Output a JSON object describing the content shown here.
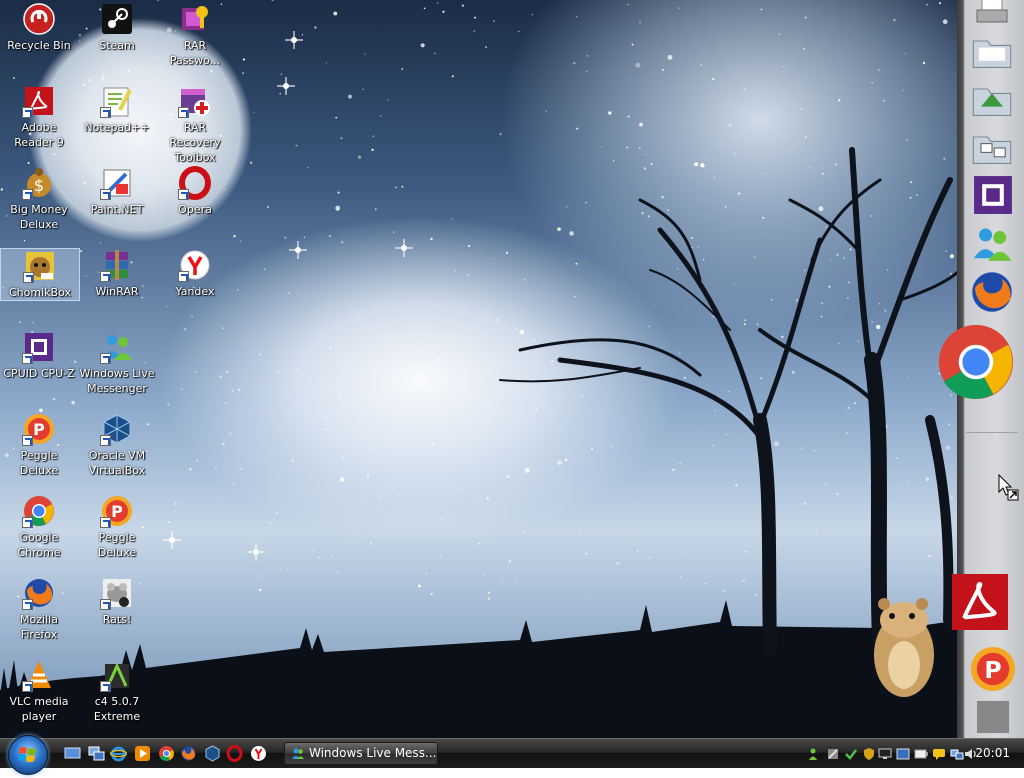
{
  "desktop": {
    "icons": [
      {
        "label": "Recycle Bin",
        "icon": "recycle-bin-icon"
      },
      {
        "label": "Steam",
        "icon": "steam-icon"
      },
      {
        "label": "RAR Passwo...",
        "icon": "rar-password-icon"
      },
      {
        "label": "Adobe Reader 9",
        "icon": "adobe-reader-icon"
      },
      {
        "label": "Notepad++",
        "icon": "notepad-plus-plus-icon"
      },
      {
        "label": "RAR Recovery Toolbox",
        "icon": "rar-recovery-toolbox-icon"
      },
      {
        "label": "Big Money Deluxe",
        "icon": "big-money-deluxe-icon"
      },
      {
        "label": "Paint.NET",
        "icon": "paint-net-icon"
      },
      {
        "label": "Opera",
        "icon": "opera-icon"
      },
      {
        "label": "ChomikBox",
        "icon": "chomikbox-icon"
      },
      {
        "label": "WinRAR",
        "icon": "winrar-icon"
      },
      {
        "label": "Yandex",
        "icon": "yandex-icon"
      },
      {
        "label": "CPUID CPU-Z",
        "icon": "cpu-z-icon"
      },
      {
        "label": "Windows Live Messenger",
        "icon": "messenger-icon"
      },
      {
        "label": "Peggle Deluxe",
        "icon": "peggle-icon"
      },
      {
        "label": "Oracle VM VirtualBox",
        "icon": "virtualbox-icon"
      },
      {
        "label": "Google Chrome",
        "icon": "chrome-icon"
      },
      {
        "label": "Peggle Deluxe",
        "icon": "peggle-icon"
      },
      {
        "label": "Mozilla Firefox",
        "icon": "firefox-icon"
      },
      {
        "label": "Rats!",
        "icon": "rats-icon"
      },
      {
        "label": "VLC media player",
        "icon": "vlc-icon"
      },
      {
        "label": "c4 5.0.7 Extreme",
        "icon": "c4-extreme-icon"
      }
    ],
    "selected_label": "ChomikBox"
  },
  "dock": {
    "items": [
      "printer-icon",
      "folder-icon",
      "folder-green-icon",
      "folder-network-icon",
      "cpu-z-icon",
      "messenger-icon",
      "firefox-icon",
      "chrome-icon",
      "adobe-reader-icon",
      "peggle-icon",
      "paint-icon"
    ]
  },
  "taskbar": {
    "start_button": "windows-orb-icon",
    "quick_launch": [
      "show-desktop-icon",
      "switch-windows-icon",
      "internet-explorer-icon",
      "media-player-icon",
      "chrome-icon",
      "firefox-icon",
      "virtualbox-icon",
      "opera-icon",
      "yandex-icon"
    ],
    "task_button_label": "Windows Live Mess...",
    "tray_icons": [
      "messenger-status-icon",
      "network-tool-icon",
      "antivirus-check-icon",
      "shield-icon",
      "monitor-icon",
      "display-icon",
      "battery-icon",
      "chat-icon",
      "network-icon",
      "volume-icon"
    ],
    "clock": "20:01"
  },
  "colors": {
    "taskbar": "#1d1d1d",
    "dock": "#d8dadd",
    "chrome_red": "#db4437",
    "chrome_yellow": "#f4b400",
    "chrome_green": "#0f9d58",
    "chrome_blue": "#4285f4",
    "adobe_red": "#c4121a"
  }
}
